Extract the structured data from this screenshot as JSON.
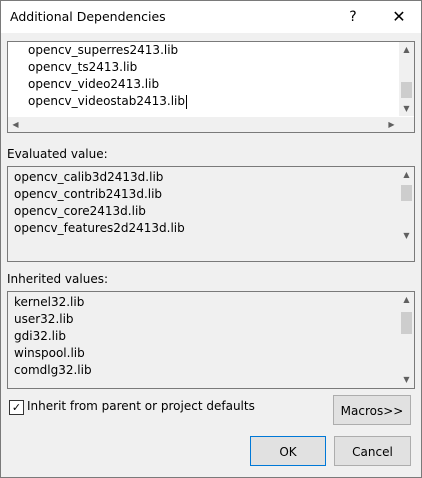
{
  "window": {
    "title": "Additional Dependencies",
    "help_glyph": "?",
    "close_glyph": "✕"
  },
  "editor": {
    "lines": [
      "opencv_superres2413.lib",
      "opencv_ts2413.lib",
      "opencv_video2413.lib",
      "opencv_videostab2413.lib"
    ]
  },
  "evaluated": {
    "label": "Evaluated value:",
    "lines": [
      "opencv_calib3d2413d.lib",
      "opencv_contrib2413d.lib",
      "opencv_core2413d.lib",
      "opencv_features2d2413d.lib"
    ]
  },
  "inherited": {
    "label": "Inherited values:",
    "lines": [
      "kernel32.lib",
      "user32.lib",
      "gdi32.lib",
      "winspool.lib",
      "comdlg32.lib"
    ]
  },
  "inherit_checkbox": {
    "label": "Inherit from parent or project defaults",
    "checked": true,
    "check_glyph": "✓"
  },
  "buttons": {
    "macros": "Macros>>",
    "ok": "OK",
    "cancel": "Cancel"
  },
  "scroll_glyphs": {
    "up": "▲",
    "down": "▼",
    "left": "◀",
    "right": "▶"
  }
}
